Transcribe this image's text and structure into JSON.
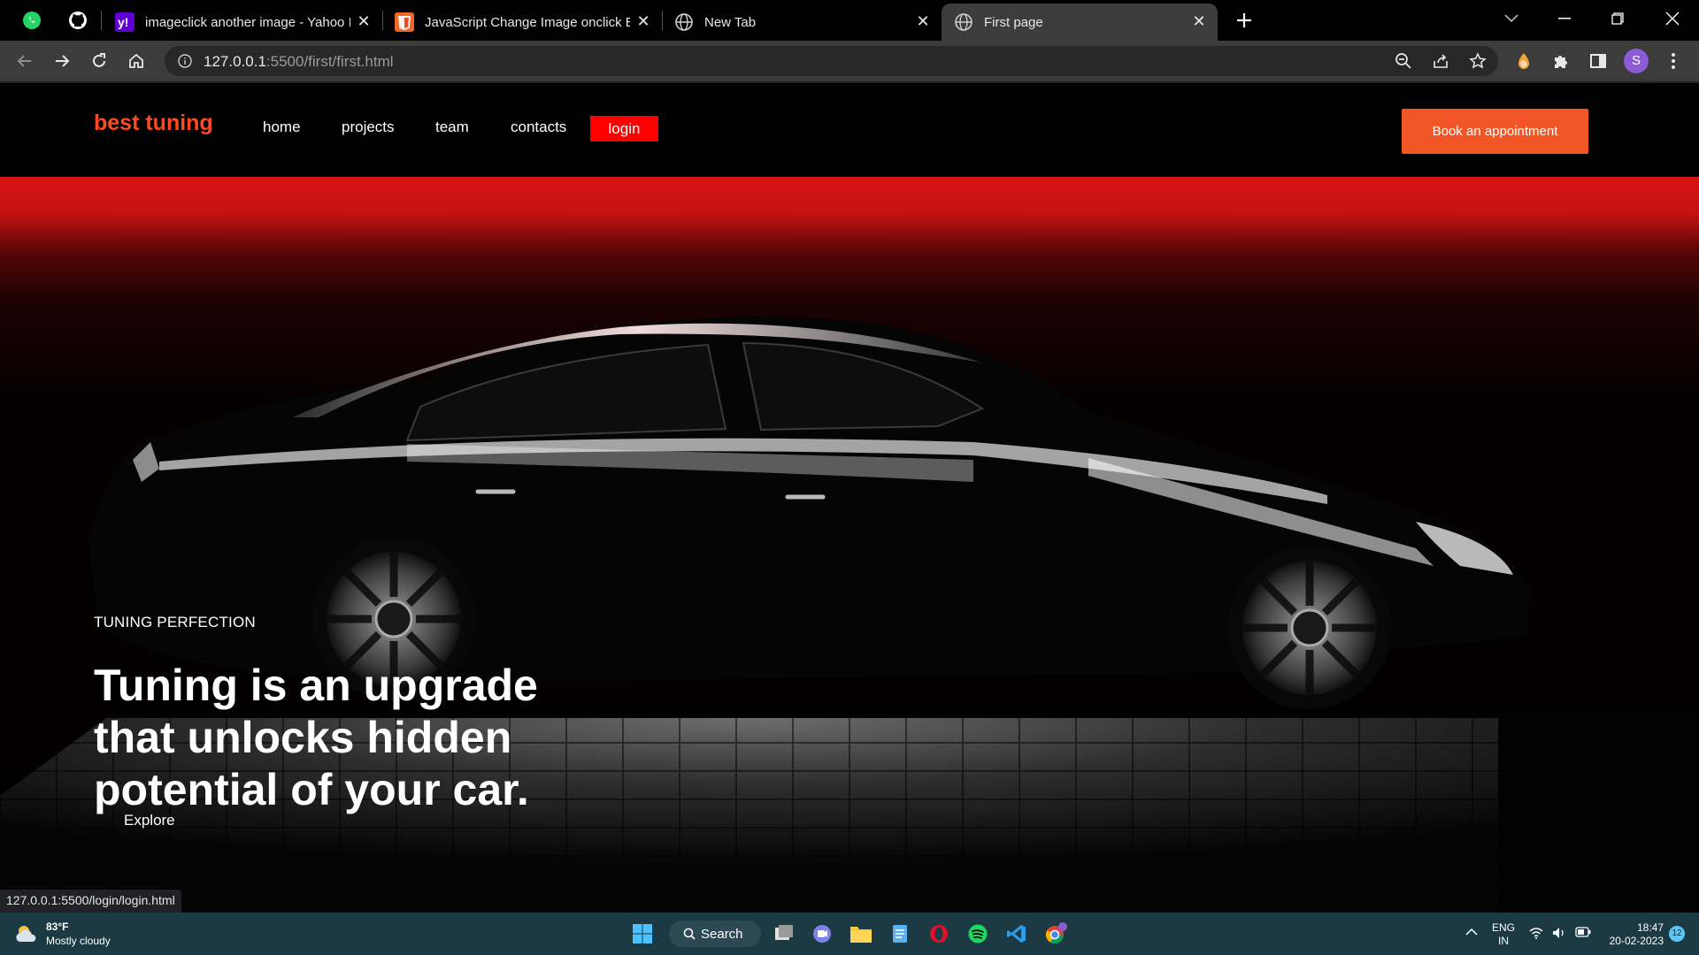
{
  "browser": {
    "tabs": [
      {
        "title": "imageclick another image - Yahoo Im",
        "icon": "yahoo-icon"
      },
      {
        "title": "JavaScript Change Image onclick Eve",
        "icon": "site-icon"
      },
      {
        "title": "New Tab",
        "icon": "globe-icon"
      },
      {
        "title": "First page",
        "icon": "globe-icon",
        "active": true
      }
    ],
    "pinned": [
      "whatsapp-icon",
      "github-icon"
    ],
    "url_host": "127.0.0.1",
    "url_path": ":5500/first/first.html",
    "profile_initial": "S",
    "accent": "#8e5bd6"
  },
  "site": {
    "brand": "best tuning",
    "nav": {
      "home": "home",
      "projects": "projects",
      "team": "team",
      "contacts": "contacts",
      "login": "login"
    },
    "cta": "Book an appointment",
    "hero": {
      "kicker": "TUNING PERFECTION",
      "headline": "Tuning is an upgrade that unlocks hidden potential of your car.",
      "explore": "Explore"
    },
    "colors": {
      "brand": "#ff4a1f",
      "login_bg": "#ff0000",
      "cta_bg": "#f25626",
      "hero_glow": "#d81515"
    }
  },
  "status_url": "127.0.0.1:5500/login/login.html",
  "taskbar": {
    "weather_temp": "83°F",
    "weather_desc": "Mostly cloudy",
    "search": "Search",
    "lang_top": "ENG",
    "lang_bottom": "IN",
    "time": "18:47",
    "date": "20-02-2023",
    "notifications": "12"
  }
}
